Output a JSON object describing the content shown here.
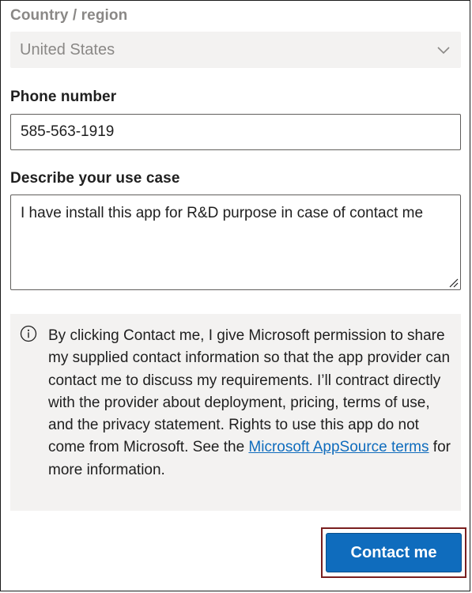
{
  "form": {
    "country": {
      "label": "Country / region",
      "value": "United States",
      "icon": "chevron-down-icon"
    },
    "phone": {
      "label": "Phone number",
      "value": "585-563-1919"
    },
    "use_case": {
      "label": "Describe your use case",
      "value": "I have install this app for R&D purpose in case of contact me"
    }
  },
  "notice": {
    "icon": "info-icon",
    "text_before": "By clicking Contact me, I give Microsoft permission to share my supplied contact information so that the app provider can contact me to discuss my requirements. I’ll contract directly with the provider about deployment, pricing, terms of use, and the privacy statement. Rights to use this app do not come from Microsoft. See the ",
    "link_text": "Microsoft AppSource terms",
    "text_after": " for more information."
  },
  "actions": {
    "contact_label": "Contact me"
  },
  "colors": {
    "accent": "#0f6cbd",
    "highlight_border": "#7a1f1f",
    "panel_background": "#f3f2f1"
  }
}
